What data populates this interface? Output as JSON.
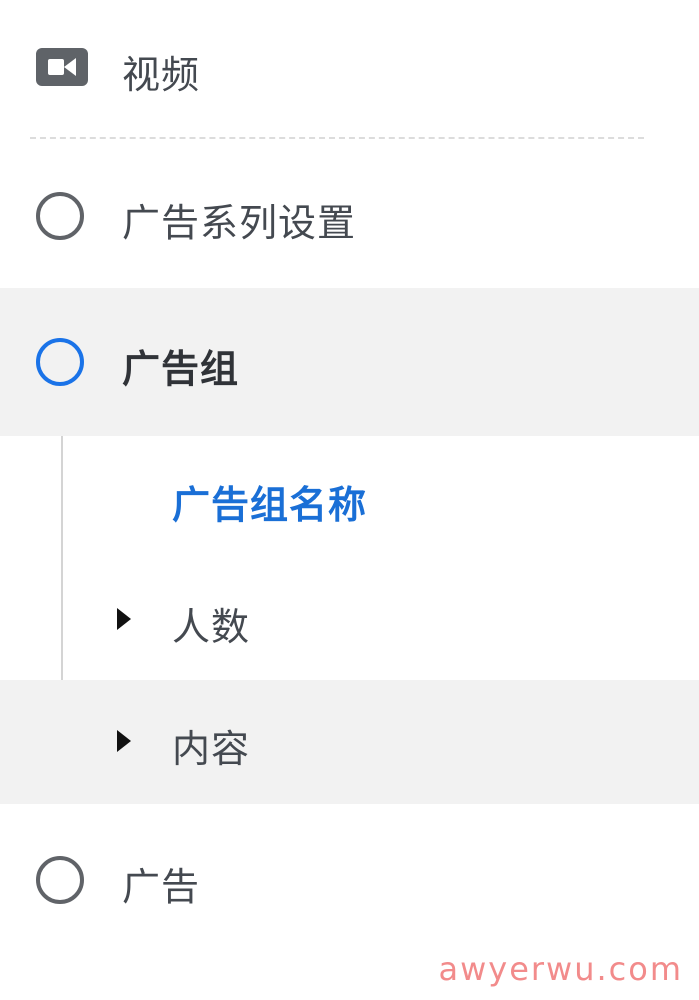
{
  "menu": {
    "video": {
      "label": "视频",
      "icon": "video-camera-icon"
    },
    "campaign": {
      "label": "广告系列设置",
      "icon": "radio-circle-icon"
    },
    "adset": {
      "label": "广告组",
      "icon": "radio-circle-icon",
      "active": true,
      "accent": "#1a73e8",
      "children": [
        {
          "label": "广告组名称",
          "selected": true,
          "color": "#1a6fd6"
        },
        {
          "label": "人数",
          "icon": "caret-right-icon",
          "expanded": false
        },
        {
          "label": "内容",
          "icon": "caret-right-icon",
          "expanded": false
        }
      ]
    },
    "ad": {
      "label": "广告",
      "icon": "radio-circle-icon"
    }
  },
  "watermark": "awyerwu.com"
}
